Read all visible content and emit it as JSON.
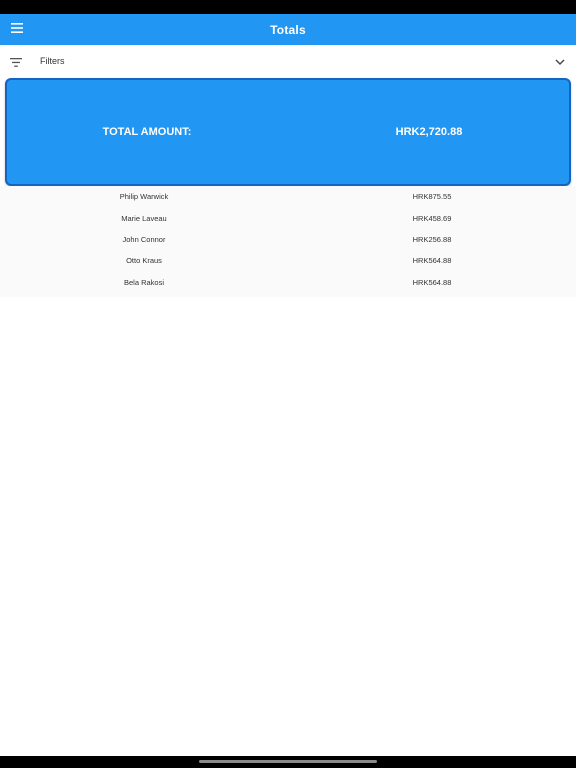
{
  "app_bar": {
    "title": "Totals",
    "menu_icon": "hamburger-menu-icon",
    "background": "#2196F3"
  },
  "filters": {
    "label": "Filters",
    "icon": "filter-list-icon",
    "chevron_icon": "chevron-down-icon"
  },
  "total": {
    "label": "TOTAL AMOUNT:",
    "value": "HRK2,720.88",
    "background": "#2196F3"
  },
  "rows": [
    {
      "name": "Philip Warwick",
      "amount": "HRK875.55"
    },
    {
      "name": "Marie Laveau",
      "amount": "HRK458.69"
    },
    {
      "name": "John Connor",
      "amount": "HRK256.88"
    },
    {
      "name": "Otto Kraus",
      "amount": "HRK564.88"
    },
    {
      "name": "Bela Rakosi",
      "amount": "HRK564.88"
    }
  ]
}
